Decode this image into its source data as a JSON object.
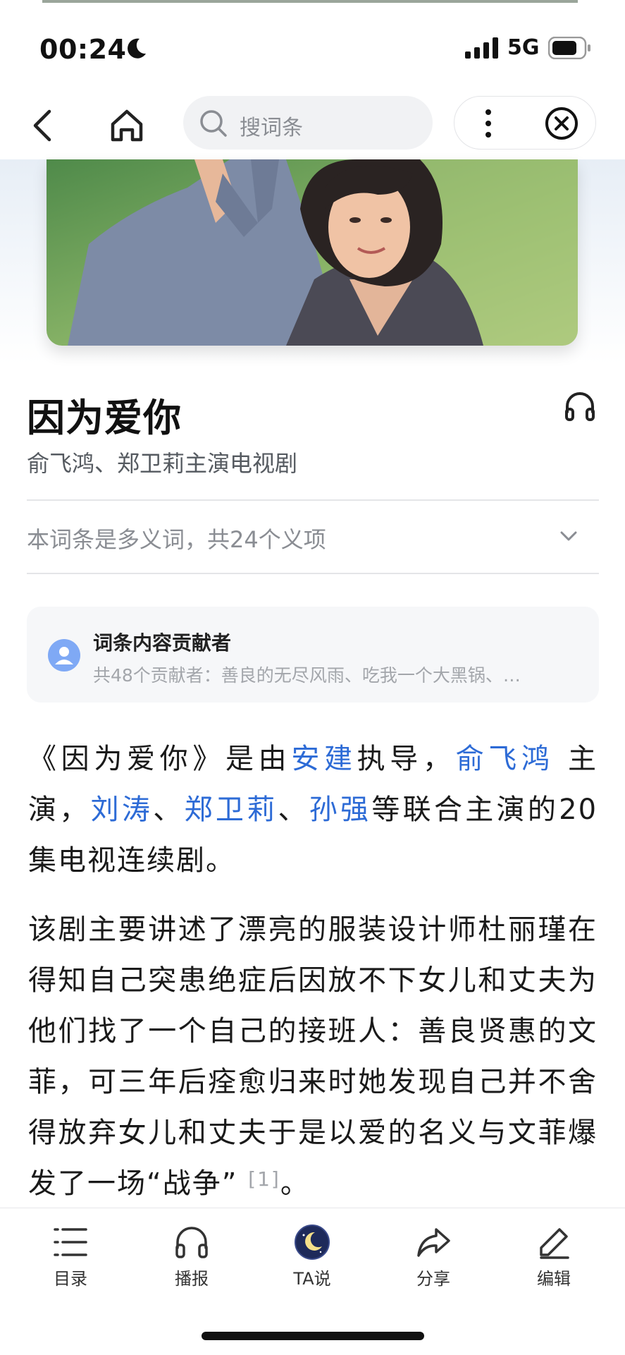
{
  "status": {
    "time": "00:24",
    "network": "5G"
  },
  "nav": {
    "search_placeholder": "搜词条"
  },
  "article": {
    "title": "因为爱你",
    "subtitle": "俞飞鸿、郑卫莉主演电视剧",
    "polysemy_note": "本词条是多义词，共24个义项"
  },
  "contributors": {
    "title": "词条内容贡献者",
    "summary": "共48个贡献者：善良的无尽风雨、吃我一个大黑锅、…"
  },
  "paragraph1": {
    "p1": "《因为爱你》是由",
    "director": "安建",
    "p2": "执导，",
    "actor1": "俞飞鸿",
    "p3": " 主演，",
    "actor2": "刘涛",
    "sep1": "、",
    "actor3": "郑卫莉",
    "sep2": "、",
    "actor4": "孙强",
    "p4": "等联合主演的20集电视连续剧。"
  },
  "paragraph2": {
    "text": "该剧主要讲述了漂亮的服装设计师杜丽瑾在得知自己突患绝症后因放不下女儿和丈夫为他们找了一个自己的接班人：善良贤惠的文菲，可三年后痊愈归来时她发现自己并不舍得放弃女儿和丈夫于是以爱的名义与文菲爆发了一场“战争”",
    "citation": "[1]",
    "end": "。"
  },
  "toolbar": {
    "items": [
      {
        "label": "目录",
        "icon": "list-icon"
      },
      {
        "label": "播报",
        "icon": "headphones-icon"
      },
      {
        "label": "TA说",
        "icon": "moon-icon"
      },
      {
        "label": "分享",
        "icon": "share-icon"
      },
      {
        "label": "编辑",
        "icon": "edit-icon"
      }
    ]
  },
  "colors": {
    "link": "#2d6bd6",
    "muted": "#8a8d93",
    "card_bg": "#f6f7f9"
  }
}
